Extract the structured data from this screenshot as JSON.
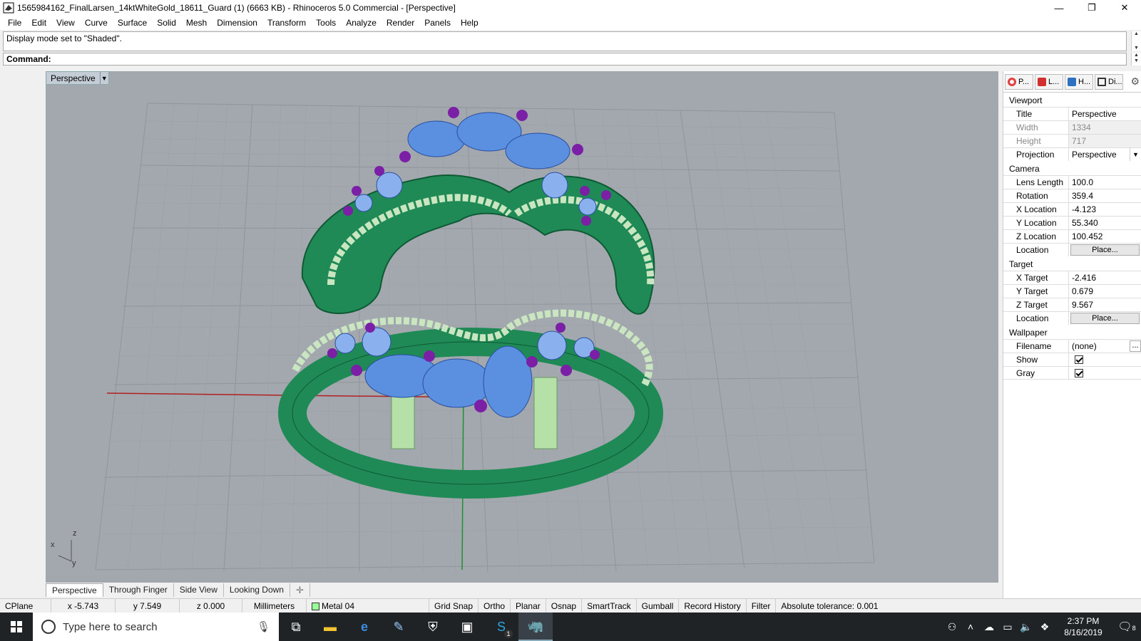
{
  "window": {
    "title": "1565984162_FinalLarsen_14ktWhiteGold_18611_Guard (1) (6663 KB) - Rhinoceros 5.0 Commercial - [Perspective]",
    "minimize": "—",
    "restore": "❐",
    "close": "✕"
  },
  "menu": [
    "File",
    "Edit",
    "View",
    "Curve",
    "Surface",
    "Solid",
    "Mesh",
    "Dimension",
    "Transform",
    "Tools",
    "Analyze",
    "Render",
    "Panels",
    "Help"
  ],
  "command_history": "Display mode set to \"Shaded\".",
  "command_prompt": "Command:",
  "viewport": {
    "label": "Perspective",
    "axis_x": "x",
    "axis_y": "y",
    "axis_z": "z"
  },
  "viewport_tabs": [
    "Perspective",
    "Through Finger",
    "Side View",
    "Looking Down"
  ],
  "viewport_tab_add": "✛",
  "status": {
    "cplane": "CPlane",
    "x": "x -5.743",
    "y": "y 7.549",
    "z": "z 0.000",
    "units": "Millimeters",
    "layer": "Metal 04",
    "grid_snap": "Grid Snap",
    "ortho": "Ortho",
    "planar": "Planar",
    "osnap": "Osnap",
    "smarttrack": "SmartTrack",
    "gumball": "Gumball",
    "record_history": "Record History",
    "filter": "Filter",
    "tolerance": "Absolute tolerance: 0.001"
  },
  "panel": {
    "tabs": [
      {
        "label": "P...",
        "color": "#e04040"
      },
      {
        "label": "L...",
        "color": "#d03030"
      },
      {
        "label": "H...",
        "color": "#3070c0"
      },
      {
        "label": "Di...",
        "color": "#333333"
      }
    ],
    "viewport_heading": "Viewport",
    "title_label": "Title",
    "title_value": "Perspective",
    "width_label": "Width",
    "width_value": "1334",
    "height_label": "Height",
    "height_value": "717",
    "projection_label": "Projection",
    "projection_value": "Perspective",
    "camera_heading": "Camera",
    "lens_label": "Lens Length",
    "lens_value": "100.0",
    "rotation_label": "Rotation",
    "rotation_value": "359.4",
    "xloc_label": "X Location",
    "xloc_value": "-4.123",
    "yloc_label": "Y Location",
    "yloc_value": "55.340",
    "zloc_label": "Z Location",
    "zloc_value": "100.452",
    "loc_label": "Location",
    "place_button": "Place...",
    "target_heading": "Target",
    "xt_label": "X Target",
    "xt_value": "-2.416",
    "yt_label": "Y Target",
    "yt_value": "0.679",
    "zt_label": "Z Target",
    "zt_value": "9.567",
    "tloc_label": "Location",
    "tplace_button": "Place...",
    "wallpaper_heading": "Wallpaper",
    "filename_label": "Filename",
    "filename_value": "(none)",
    "browse_button": "...",
    "show_label": "Show",
    "show_checked": true,
    "gray_label": "Gray",
    "gray_checked": true
  },
  "taskbar": {
    "search_placeholder": "Type here to search",
    "time": "2:37 PM",
    "date": "8/16/2019",
    "notification_count": "8",
    "skype_badge": "1"
  },
  "colors": {
    "viewport_bg": "#a3a8ae",
    "ring_green": "#1f8a55",
    "gem_blue": "#5b8fe0",
    "prong_purple": "#7a1fa6",
    "bead_green": "#c9e6c0"
  }
}
